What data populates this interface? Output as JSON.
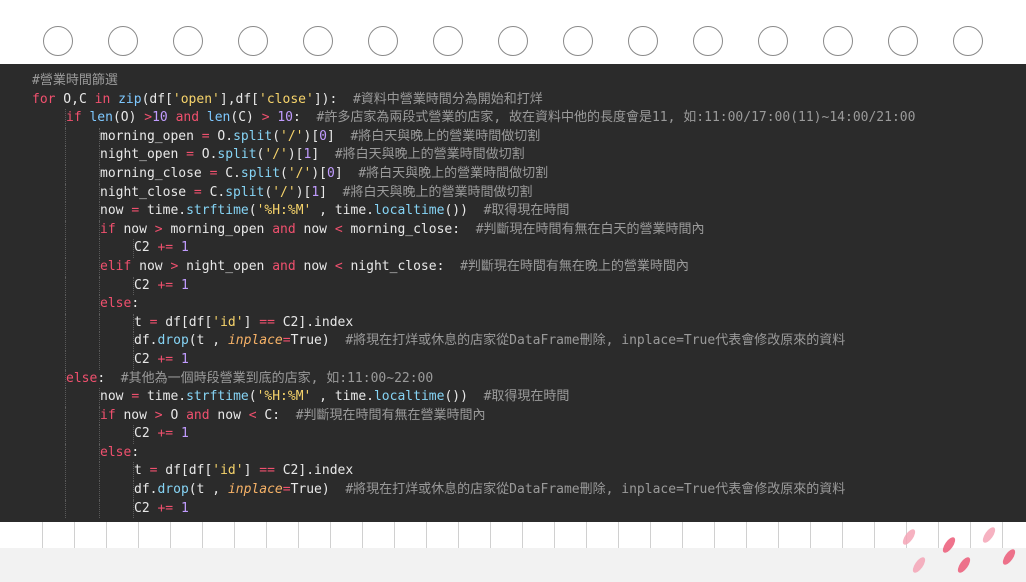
{
  "lines": [
    {
      "indent": 0,
      "segs": [
        [
          "cm",
          "#營業時間篩選"
        ]
      ]
    },
    {
      "indent": 0,
      "segs": [
        [
          "kw",
          "for"
        ],
        [
          "tx",
          " O,C "
        ],
        [
          "kw",
          "in"
        ],
        [
          "tx",
          " "
        ],
        [
          "bi",
          "zip"
        ],
        [
          "tx",
          "(df["
        ],
        [
          "st",
          "'open'"
        ],
        [
          "tx",
          "],df["
        ],
        [
          "st",
          "'close'"
        ],
        [
          "tx",
          "]):  "
        ],
        [
          "cm",
          "#資料中營業時間分為開始和打烊"
        ]
      ]
    },
    {
      "indent": 1,
      "segs": [
        [
          "kw",
          "if"
        ],
        [
          "tx",
          " "
        ],
        [
          "bi",
          "len"
        ],
        [
          "tx",
          "(O) "
        ],
        [
          "kw",
          ">"
        ],
        [
          "nm",
          "10"
        ],
        [
          "tx",
          " "
        ],
        [
          "kw",
          "and"
        ],
        [
          "tx",
          " "
        ],
        [
          "bi",
          "len"
        ],
        [
          "tx",
          "(C) "
        ],
        [
          "kw",
          ">"
        ],
        [
          "tx",
          " "
        ],
        [
          "nm",
          "10"
        ],
        [
          "tx",
          ":  "
        ],
        [
          "cm",
          "#許多店家為兩段式營業的店家, 故在資料中他的長度會是11, 如:11:00/17:00(11)~14:00/21:00"
        ]
      ]
    },
    {
      "indent": 2,
      "segs": [
        [
          "tx",
          "morning_open "
        ],
        [
          "kw",
          "="
        ],
        [
          "tx",
          " O."
        ],
        [
          "fn",
          "split"
        ],
        [
          "tx",
          "("
        ],
        [
          "st",
          "'/'"
        ],
        [
          "tx",
          ")["
        ],
        [
          "nm",
          "0"
        ],
        [
          "tx",
          "]  "
        ],
        [
          "cm",
          "#將白天與晚上的營業時間做切割"
        ]
      ]
    },
    {
      "indent": 2,
      "segs": [
        [
          "tx",
          "night_open "
        ],
        [
          "kw",
          "="
        ],
        [
          "tx",
          " O."
        ],
        [
          "fn",
          "split"
        ],
        [
          "tx",
          "("
        ],
        [
          "st",
          "'/'"
        ],
        [
          "tx",
          ")["
        ],
        [
          "nm",
          "1"
        ],
        [
          "tx",
          "]  "
        ],
        [
          "cm",
          "#將白天與晚上的營業時間做切割"
        ]
      ]
    },
    {
      "indent": 2,
      "segs": [
        [
          "tx",
          "morning_close "
        ],
        [
          "kw",
          "="
        ],
        [
          "tx",
          " C."
        ],
        [
          "fn",
          "split"
        ],
        [
          "tx",
          "("
        ],
        [
          "st",
          "'/'"
        ],
        [
          "tx",
          ")["
        ],
        [
          "nm",
          "0"
        ],
        [
          "tx",
          "]  "
        ],
        [
          "cm",
          "#將白天與晚上的營業時間做切割"
        ]
      ]
    },
    {
      "indent": 2,
      "segs": [
        [
          "tx",
          "night_close "
        ],
        [
          "kw",
          "="
        ],
        [
          "tx",
          " C."
        ],
        [
          "fn",
          "split"
        ],
        [
          "tx",
          "("
        ],
        [
          "st",
          "'/'"
        ],
        [
          "tx",
          ")["
        ],
        [
          "nm",
          "1"
        ],
        [
          "tx",
          "]  "
        ],
        [
          "cm",
          "#將白天與晚上的營業時間做切割"
        ]
      ]
    },
    {
      "indent": 2,
      "segs": [
        [
          "tx",
          "now "
        ],
        [
          "kw",
          "="
        ],
        [
          "tx",
          " time."
        ],
        [
          "fn",
          "strftime"
        ],
        [
          "tx",
          "("
        ],
        [
          "st",
          "'%H:%M'"
        ],
        [
          "tx",
          " , time."
        ],
        [
          "fn",
          "localtime"
        ],
        [
          "tx",
          "())  "
        ],
        [
          "cm",
          "#取得現在時間"
        ]
      ]
    },
    {
      "indent": 2,
      "segs": [
        [
          "kw",
          "if"
        ],
        [
          "tx",
          " now "
        ],
        [
          "kw",
          ">"
        ],
        [
          "tx",
          " morning_open "
        ],
        [
          "kw",
          "and"
        ],
        [
          "tx",
          " now "
        ],
        [
          "kw",
          "<"
        ],
        [
          "tx",
          " morning_close:  "
        ],
        [
          "cm",
          "#判斷現在時間有無在白天的營業時間內"
        ]
      ]
    },
    {
      "indent": 3,
      "segs": [
        [
          "tx",
          "C2 "
        ],
        [
          "kw",
          "+="
        ],
        [
          "tx",
          " "
        ],
        [
          "nm",
          "1"
        ]
      ]
    },
    {
      "indent": 2,
      "segs": [
        [
          "kw",
          "elif"
        ],
        [
          "tx",
          " now "
        ],
        [
          "kw",
          ">"
        ],
        [
          "tx",
          " night_open "
        ],
        [
          "kw",
          "and"
        ],
        [
          "tx",
          " now "
        ],
        [
          "kw",
          "<"
        ],
        [
          "tx",
          " night_close:  "
        ],
        [
          "cm",
          "#判斷現在時間有無在晚上的營業時間內"
        ]
      ]
    },
    {
      "indent": 3,
      "segs": [
        [
          "tx",
          "C2 "
        ],
        [
          "kw",
          "+="
        ],
        [
          "tx",
          " "
        ],
        [
          "nm",
          "1"
        ]
      ]
    },
    {
      "indent": 2,
      "segs": [
        [
          "kw",
          "else"
        ],
        [
          "tx",
          ":"
        ]
      ]
    },
    {
      "indent": 3,
      "segs": [
        [
          "tx",
          "t "
        ],
        [
          "kw",
          "="
        ],
        [
          "tx",
          " df[df["
        ],
        [
          "st",
          "'id'"
        ],
        [
          "tx",
          "] "
        ],
        [
          "kw",
          "=="
        ],
        [
          "tx",
          " C2].index"
        ]
      ]
    },
    {
      "indent": 3,
      "segs": [
        [
          "tx",
          "df."
        ],
        [
          "fn",
          "drop"
        ],
        [
          "tx",
          "(t , "
        ],
        [
          "pa",
          "inplace"
        ],
        [
          "kw",
          "="
        ],
        [
          "tx",
          "True)  "
        ],
        [
          "cm",
          "#將現在打烊或休息的店家從DataFrame刪除, inplace=True代表會修改原來的資料"
        ]
      ]
    },
    {
      "indent": 3,
      "segs": [
        [
          "tx",
          "C2 "
        ],
        [
          "kw",
          "+="
        ],
        [
          "tx",
          " "
        ],
        [
          "nm",
          "1"
        ]
      ]
    },
    {
      "indent": 1,
      "segs": [
        [
          "kw",
          "else"
        ],
        [
          "tx",
          ":  "
        ],
        [
          "cm",
          "#其他為一個時段營業到底的店家, 如:11:00~22:00"
        ]
      ]
    },
    {
      "indent": 2,
      "segs": [
        [
          "tx",
          "now "
        ],
        [
          "kw",
          "="
        ],
        [
          "tx",
          " time."
        ],
        [
          "fn",
          "strftime"
        ],
        [
          "tx",
          "("
        ],
        [
          "st",
          "'%H:%M'"
        ],
        [
          "tx",
          " , time."
        ],
        [
          "fn",
          "localtime"
        ],
        [
          "tx",
          "())  "
        ],
        [
          "cm",
          "#取得現在時間"
        ]
      ]
    },
    {
      "indent": 2,
      "segs": [
        [
          "kw",
          "if"
        ],
        [
          "tx",
          " now "
        ],
        [
          "kw",
          ">"
        ],
        [
          "tx",
          " O "
        ],
        [
          "kw",
          "and"
        ],
        [
          "tx",
          " now "
        ],
        [
          "kw",
          "<"
        ],
        [
          "tx",
          " C:  "
        ],
        [
          "cm",
          "#判斷現在時間有無在營業時間內"
        ]
      ]
    },
    {
      "indent": 3,
      "segs": [
        [
          "tx",
          "C2 "
        ],
        [
          "kw",
          "+="
        ],
        [
          "tx",
          " "
        ],
        [
          "nm",
          "1"
        ]
      ]
    },
    {
      "indent": 2,
      "segs": [
        [
          "kw",
          "else"
        ],
        [
          "tx",
          ":"
        ]
      ]
    },
    {
      "indent": 3,
      "segs": [
        [
          "tx",
          "t "
        ],
        [
          "kw",
          "="
        ],
        [
          "tx",
          " df[df["
        ],
        [
          "st",
          "'id'"
        ],
        [
          "tx",
          "] "
        ],
        [
          "kw",
          "=="
        ],
        [
          "tx",
          " C2].index"
        ]
      ]
    },
    {
      "indent": 3,
      "segs": [
        [
          "tx",
          "df."
        ],
        [
          "fn",
          "drop"
        ],
        [
          "tx",
          "(t , "
        ],
        [
          "pa",
          "inplace"
        ],
        [
          "kw",
          "="
        ],
        [
          "tx",
          "True)  "
        ],
        [
          "cm",
          "#將現在打烊或休息的店家從DataFrame刪除, inplace=True代表會修改原來的資料"
        ]
      ]
    },
    {
      "indent": 3,
      "segs": [
        [
          "tx",
          "C2 "
        ],
        [
          "kw",
          "+="
        ],
        [
          "tx",
          " "
        ],
        [
          "nm",
          "1"
        ]
      ]
    }
  ],
  "colors": {
    "background": "#2b2b2b",
    "keyword": "#f0506e",
    "builtin": "#7ec8ff",
    "string": "#f7d46b",
    "number": "#c19cff",
    "comment": "#9a9a9a",
    "function": "#86d4f5",
    "param": "#f7b267"
  }
}
